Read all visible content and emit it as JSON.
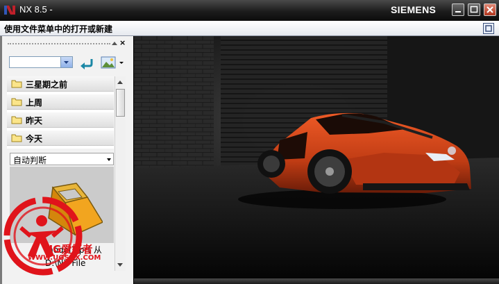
{
  "window": {
    "title": "NX 8.5 -",
    "brand": "SIEMENS",
    "minimize_icon": "minimize-icon",
    "maximize_icon": "maximize-icon",
    "close_icon": "close-icon"
  },
  "cue": {
    "text": "使用文件菜单中的打开或新建"
  },
  "history_panel": {
    "close_label": "×",
    "groups": [
      {
        "label": "三星期之前",
        "icon": "folder-icon"
      },
      {
        "label": "上周",
        "icon": "folder-icon"
      },
      {
        "label": "昨天",
        "icon": "folder-icon"
      },
      {
        "label": "今天",
        "icon": "folder-icon"
      }
    ],
    "filter_value": "自动判断",
    "caption_line1": "model1.prt 从",
    "caption_line2": "D:\\NX File"
  },
  "watermark": {
    "line1": "UG爱好者",
    "line2": "WWW.UGSNX.COM"
  },
  "colors": {
    "car": "#d2401a",
    "accent": "#e0141b"
  }
}
